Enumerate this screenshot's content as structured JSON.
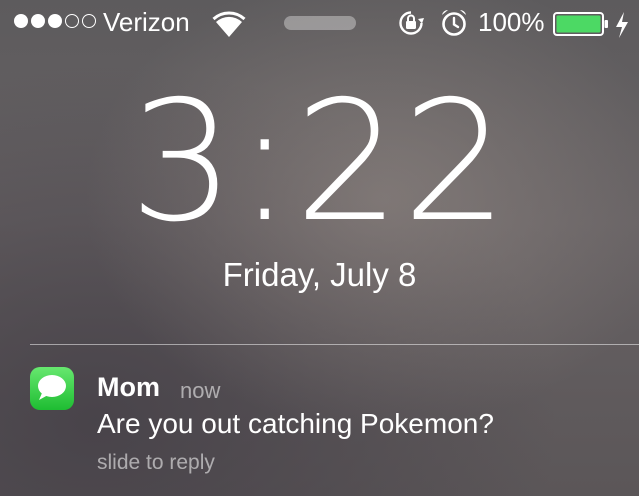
{
  "status_bar": {
    "signal_bars_filled": 3,
    "signal_bars_total": 5,
    "carrier": "Verizon",
    "battery_percent": "100%",
    "battery_color": "#4cd964",
    "icons": [
      "wifi-icon",
      "orientation-lock-icon",
      "alarm-clock-icon",
      "battery-icon",
      "charging-bolt-icon"
    ]
  },
  "lock_screen": {
    "time": "3:22",
    "date": "Friday, July 8"
  },
  "notification": {
    "app_icon": "messages-icon",
    "app_icon_color": "#4cd964",
    "sender": "Mom",
    "time": "now",
    "message": "Are you out catching Pokemon?",
    "hint": "slide to reply"
  }
}
